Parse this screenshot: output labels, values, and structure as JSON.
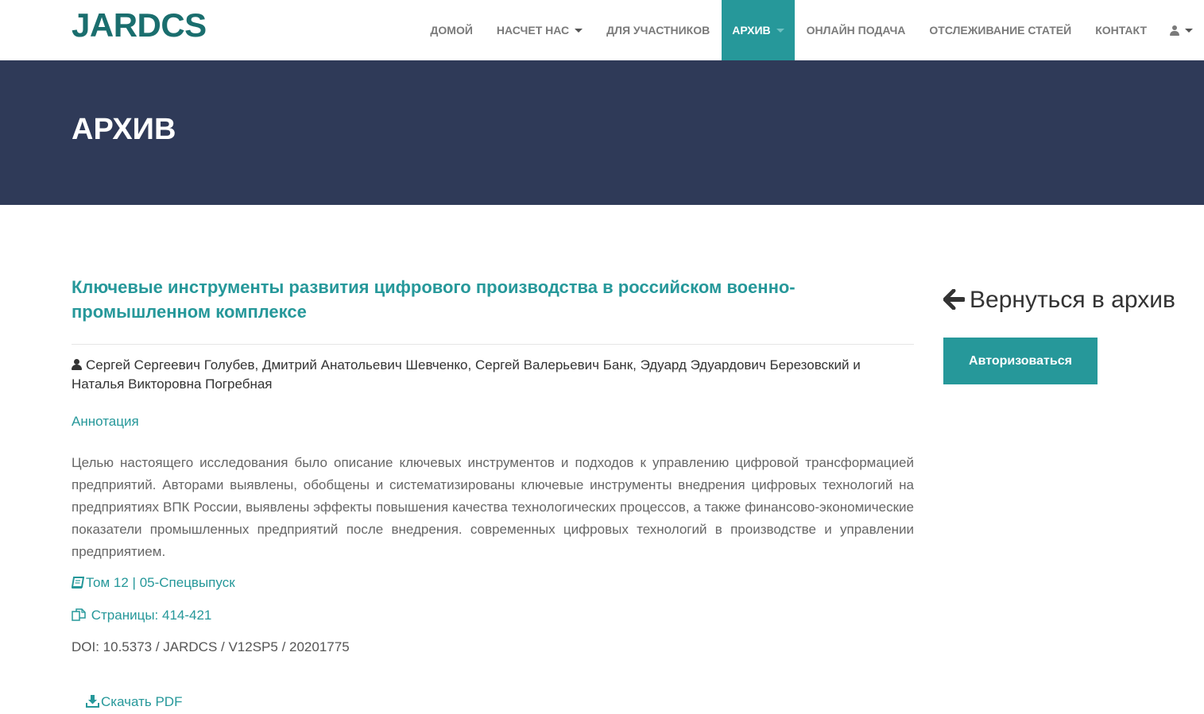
{
  "header": {
    "logo": "JARDCS",
    "nav": [
      {
        "label": "ДОМОЙ",
        "dropdown": false,
        "active": false
      },
      {
        "label": "НАСЧЕТ НАС",
        "dropdown": true,
        "active": false
      },
      {
        "label": "ДЛЯ УЧАСТНИКОВ",
        "dropdown": false,
        "active": false
      },
      {
        "label": "АРХИВ",
        "dropdown": true,
        "active": true
      },
      {
        "label": "ОНЛАЙН ПОДАЧА",
        "dropdown": false,
        "active": false
      },
      {
        "label": "ОТСЛЕЖИВАНИЕ СТАТЕЙ",
        "dropdown": false,
        "active": false
      },
      {
        "label": "КОНТАКТ",
        "dropdown": false,
        "active": false
      }
    ],
    "user_menu_icon": "user-icon"
  },
  "banner": {
    "title": "АРХИВ"
  },
  "article": {
    "title": "Ключевые инструменты развития цифрового производства в российском военно-промышленном комплексе",
    "authors": "Сергей Сергеевич Голубев, Дмитрий Анатольевич Шевченко, Сергей Валерьевич Банк, Эдуард Эдуардович Березовский и Наталья Викторовна Погребная",
    "annotation_label": "Аннотация",
    "abstract": "Целью настоящего исследования было описание ключевых инструментов и подходов к управлению цифровой трансформацией предприятий. Авторами выявлены, обобщены и систематизированы ключевые инструменты внедрения цифровых технологий на предприятиях ВПК России, выявлены эффекты повышения качества технологических процессов, а также финансово-экономические показатели промышленных предприятий после внедрения. современных цифровых технологий в производстве и управлении предприятием.",
    "volume": "Том 12 | 05-Спецвыпуск",
    "pages": "Страницы: 414-421",
    "doi": "DOI: 10.5373 / JARDCS / V12SP5 / 20201775",
    "download": "Скачать PDF"
  },
  "sidebar": {
    "back_link": "Вернуться в архив",
    "login_button": "Авторизоваться"
  },
  "colors": {
    "accent": "#26989a",
    "banner": "#2f3a58",
    "logo": "#1a6e6e"
  }
}
